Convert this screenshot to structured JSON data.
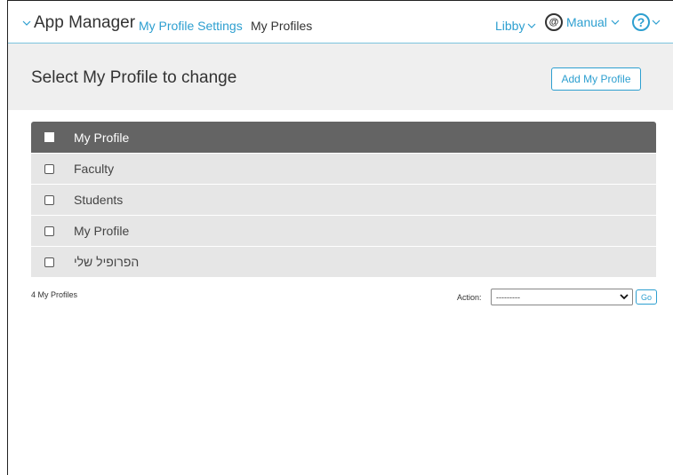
{
  "topbar": {
    "app_title": "App Manager",
    "breadcrumb_link": "My Profile Settings",
    "breadcrumb_current": "My Profiles",
    "user_name": "Libby",
    "manual_label": "Manual",
    "manual_logo_text": "@",
    "help_symbol": "?"
  },
  "header": {
    "title": "Select My Profile to change",
    "add_button": "Add My Profile"
  },
  "table": {
    "column_header": "My Profile",
    "rows": [
      "Faculty",
      "Students",
      "My Profile",
      "הפרופיל שלי"
    ]
  },
  "footer": {
    "count": "4 My Profiles",
    "action_label": "Action:",
    "action_selected": "---------",
    "go_button": "Go"
  },
  "colors": {
    "accent": "#2d9fd0",
    "header_bg": "#646464",
    "row_bg": "#e6e6e6"
  }
}
